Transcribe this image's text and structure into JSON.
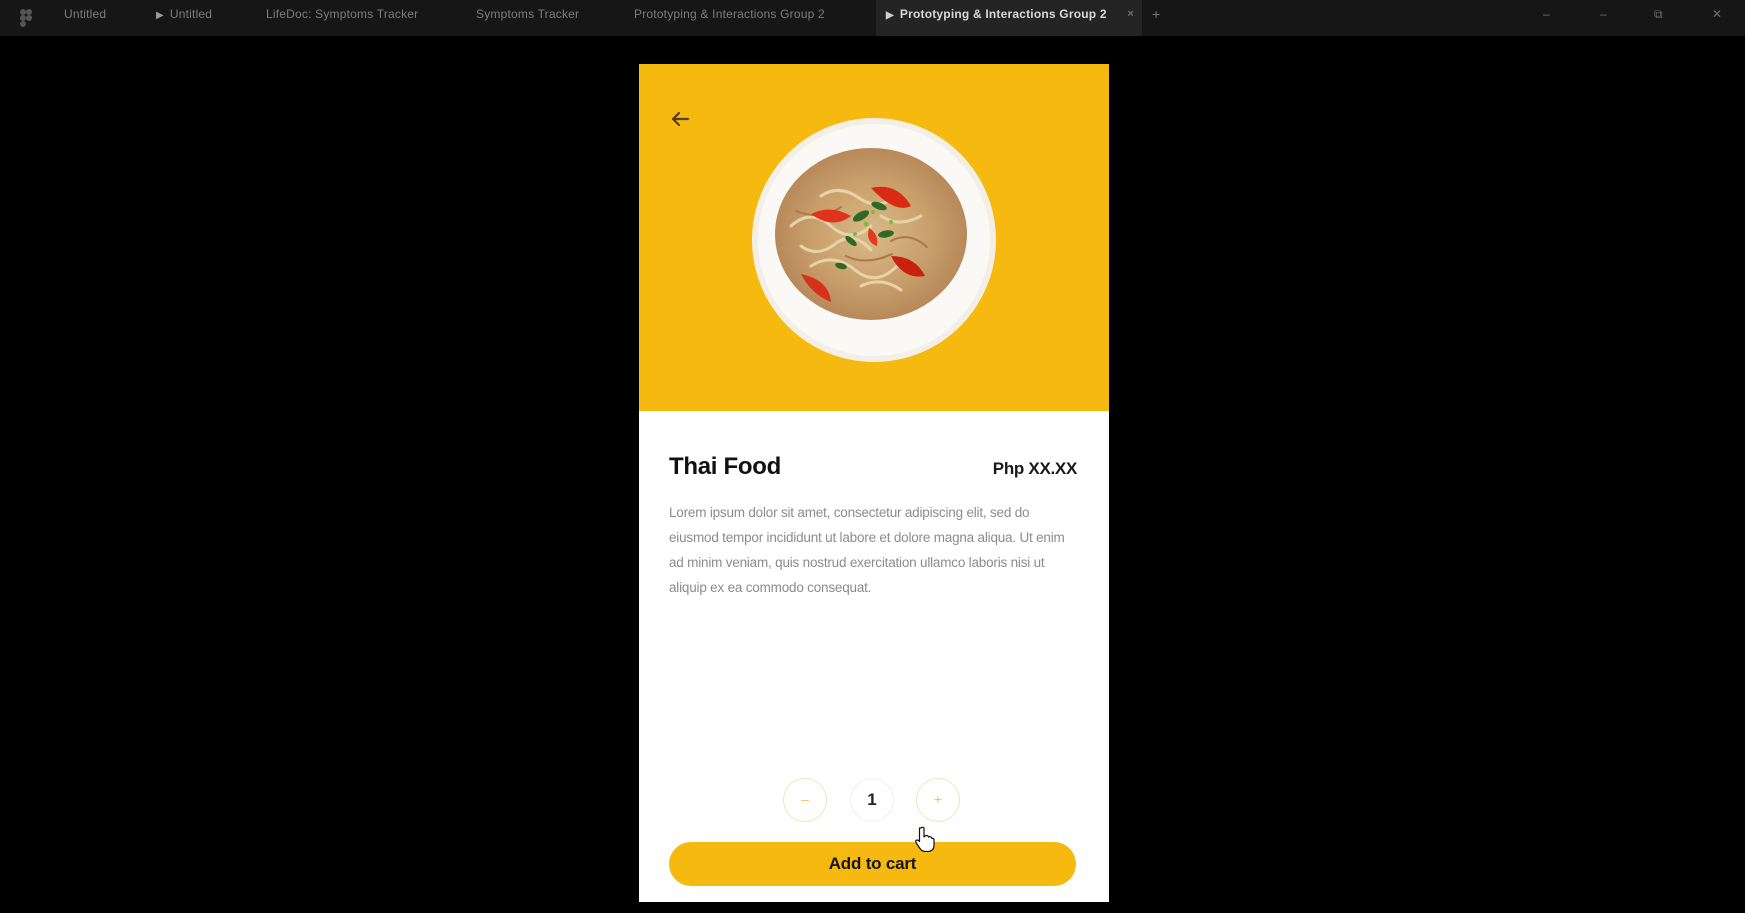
{
  "tabs": [
    {
      "label": "Untitled",
      "play": false,
      "active": false
    },
    {
      "label": "Untitled",
      "play": true,
      "active": false
    },
    {
      "label": "LifeDoc: Symptoms Tracker",
      "play": false,
      "active": false
    },
    {
      "label": "Symptoms Tracker",
      "play": false,
      "active": false
    },
    {
      "label": "Prototyping & Interactions Group 2",
      "play": false,
      "active": false
    },
    {
      "label": "Prototyping & Interactions Group 2",
      "play": true,
      "active": true
    }
  ],
  "tab_close_glyph": "×",
  "tab_add_glyph": "+",
  "window_controls": {
    "minimize": "–",
    "maximize": "–",
    "restore": "⧉",
    "close": "✕"
  },
  "product": {
    "title": "Thai Food",
    "price": "Php XX.XX",
    "description": "Lorem ipsum dolor sit amet, consectetur adipiscing elit, sed do eiusmod tempor incididunt ut labore et dolore magna aliqua. Ut enim ad minim veniam, quis nostrud exercitation ullamco laboris nisi ut aliquip ex ea commodo consequat.",
    "image_icon": "food-plate-image"
  },
  "quantity": {
    "minus_label": "–",
    "value": "1",
    "plus_label": "+"
  },
  "cart_button": {
    "label": "Add to cart"
  },
  "colors": {
    "accent": "#f5b90f",
    "background": "#000000",
    "tabbar": "#161616",
    "card": "#ffffff"
  },
  "icons": {
    "back": "arrow-left-icon",
    "cursor": "hand-pointer-icon",
    "app_logo": "figma-logo-icon"
  }
}
